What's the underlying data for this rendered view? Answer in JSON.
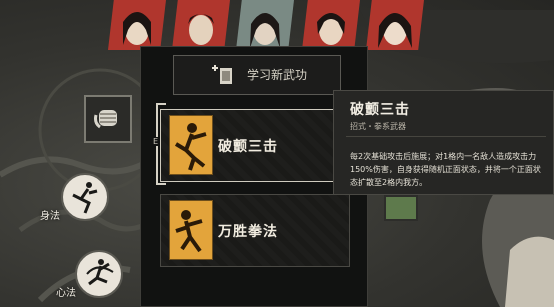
{
  "portraits": [
    {
      "name": "character-portrait-1",
      "selected": false
    },
    {
      "name": "character-portrait-2",
      "selected": false
    },
    {
      "name": "character-portrait-3",
      "selected": true
    },
    {
      "name": "character-portrait-4",
      "selected": false
    },
    {
      "name": "character-portrait-5",
      "selected": false
    }
  ],
  "side": {
    "shenfa_label": "身法",
    "xinfa_label": "心法"
  },
  "panel": {
    "learn_button_label": "学习新武功",
    "cards": [
      {
        "title": "破颤三击",
        "selected": true
      },
      {
        "title": "万胜拳法",
        "selected": false
      }
    ],
    "marker": "E"
  },
  "tooltip": {
    "title": "破颤三击",
    "subtitle": "招式・拳系武器",
    "description": "每2次基础攻击后施展；对1格内一名敌人造成攻击力150%伤害，自身获得随机正面状态，并将一个正面状态扩散至2格内我方。"
  },
  "colors": {
    "portrait_red": "#b0362d",
    "card_gold": "#e3a43b",
    "panel_bg": "#111211"
  }
}
